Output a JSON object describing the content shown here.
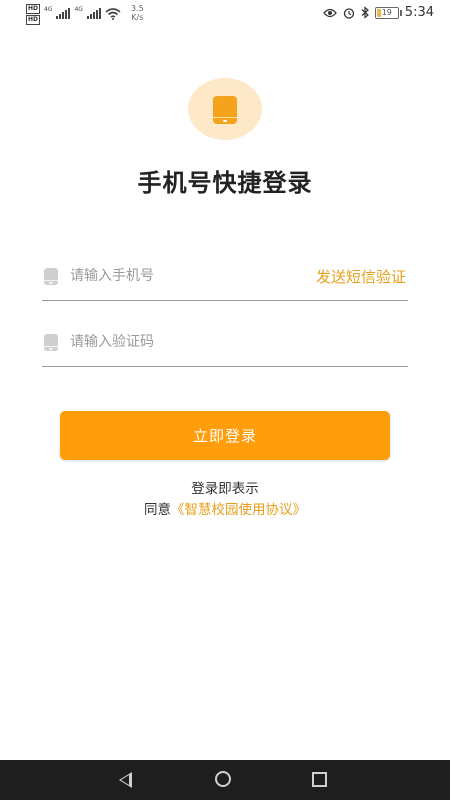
{
  "status_bar": {
    "hd1": "HD",
    "hd2": "HD",
    "net1": "4G",
    "net2": "4G",
    "speed_value": "3.5",
    "speed_unit": "K/s",
    "battery_level": "19",
    "time": "5:34"
  },
  "page": {
    "title": "手机号快捷登录"
  },
  "form": {
    "phone_placeholder": "请输入手机号",
    "phone_value": "",
    "send_code_label": "发送短信验证",
    "code_placeholder": "请输入验证码",
    "code_value": "",
    "login_label": "立即登录"
  },
  "terms": {
    "line1": "登录即表示",
    "prefix": "同意",
    "link": "《智慧校园使用协议》"
  },
  "colors": {
    "accent": "#ff9d0a",
    "link": "#e6a01c",
    "logo_bg": "#fde9c7"
  },
  "icons": [
    "phone-icon",
    "eye-icon",
    "alarm-icon",
    "bluetooth-icon",
    "battery-icon",
    "back-icon",
    "home-icon",
    "recents-icon"
  ]
}
